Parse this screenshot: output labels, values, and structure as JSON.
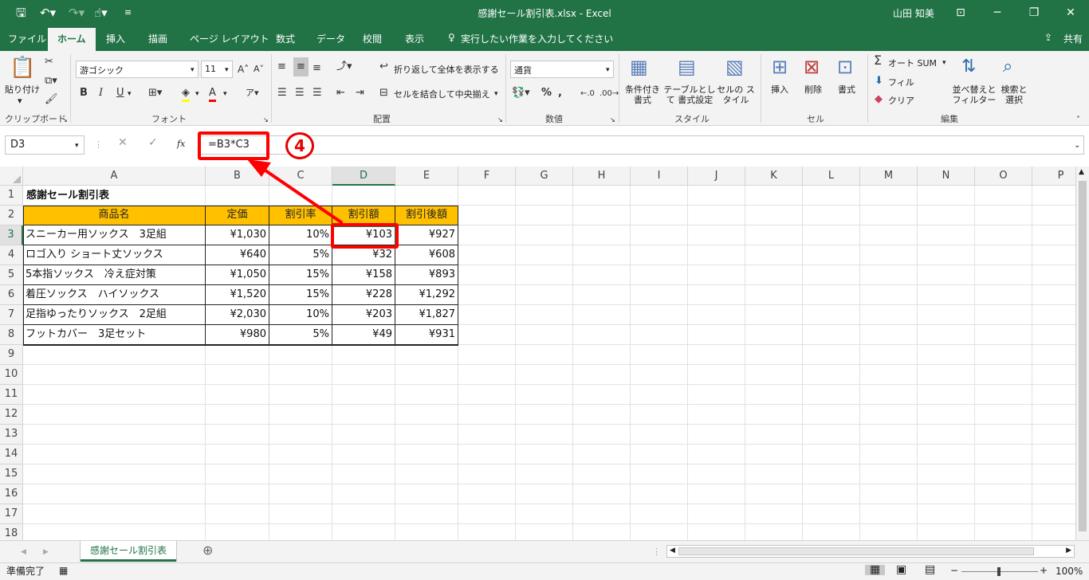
{
  "window": {
    "title": "感謝セール割引表.xlsx - Excel",
    "user": "山田 知美",
    "colors": {
      "brand": "#217346",
      "highlight": "#ff0000",
      "header_fill": "#ffc000"
    }
  },
  "tabs": [
    "ファイル",
    "ホーム",
    "挿入",
    "描画",
    "ページ レイアウト",
    "数式",
    "データ",
    "校閲",
    "表示"
  ],
  "tell_me": "実行したい作業を入力してください",
  "share": "共有",
  "ribbon": {
    "clipboard": {
      "label": "クリップボード",
      "paste": "貼り付け"
    },
    "font": {
      "label": "フォント",
      "name": "游ゴシック",
      "size": "11",
      "bold": "B",
      "italic": "I",
      "underline": "U"
    },
    "alignment": {
      "label": "配置",
      "wrap": "折り返して全体を表示する",
      "merge": "セルを結合して中央揃え"
    },
    "number": {
      "label": "数値",
      "format": "通貨"
    },
    "styles": {
      "label": "スタイル",
      "conditional": "条件付き 書式",
      "table": "テーブルとして 書式設定",
      "cell": "セルの スタイル"
    },
    "cells": {
      "label": "セル",
      "insert": "挿入",
      "delete": "削除",
      "format": "書式"
    },
    "editing": {
      "label": "編集",
      "autosum": "オート SUM",
      "fill": "フィル",
      "clear": "クリア",
      "sort": "並べ替えと フィルター",
      "find": "検索と 選択"
    }
  },
  "formula_bar": {
    "name_box": "D3",
    "formula": "=B3*C3",
    "fx": "fx"
  },
  "annotation": {
    "step": "4"
  },
  "columns": [
    "A",
    "B",
    "C",
    "D",
    "E",
    "F",
    "G",
    "H",
    "I",
    "J",
    "K",
    "L",
    "M",
    "N",
    "O",
    "P"
  ],
  "rows": [
    "1",
    "2",
    "3",
    "4",
    "5",
    "6",
    "7",
    "8",
    "9",
    "10",
    "11",
    "12",
    "13",
    "14",
    "15",
    "16",
    "17",
    "18"
  ],
  "sheet": {
    "title": "感謝セール割引表",
    "headers": [
      "商品名",
      "定価",
      "割引率",
      "割引額",
      "割引後額"
    ],
    "data": [
      [
        "スニーカー用ソックス　3足組",
        "¥1,030",
        "10%",
        "¥103",
        "¥927"
      ],
      [
        "ロゴ入り ショート丈ソックス",
        "¥640",
        "5%",
        "¥32",
        "¥608"
      ],
      [
        "5本指ソックス　冷え症対策",
        "¥1,050",
        "15%",
        "¥158",
        "¥893"
      ],
      [
        "着圧ソックス　ハイソックス",
        "¥1,520",
        "15%",
        "¥228",
        "¥1,292"
      ],
      [
        "足指ゆったりソックス　2足組",
        "¥2,030",
        "10%",
        "¥203",
        "¥1,827"
      ],
      [
        "フットカバー　3足セット",
        "¥980",
        "5%",
        "¥49",
        "¥931"
      ]
    ]
  },
  "sheet_tab": "感謝セール割引表",
  "status": {
    "ready": "準備完了",
    "zoom": "100%"
  }
}
